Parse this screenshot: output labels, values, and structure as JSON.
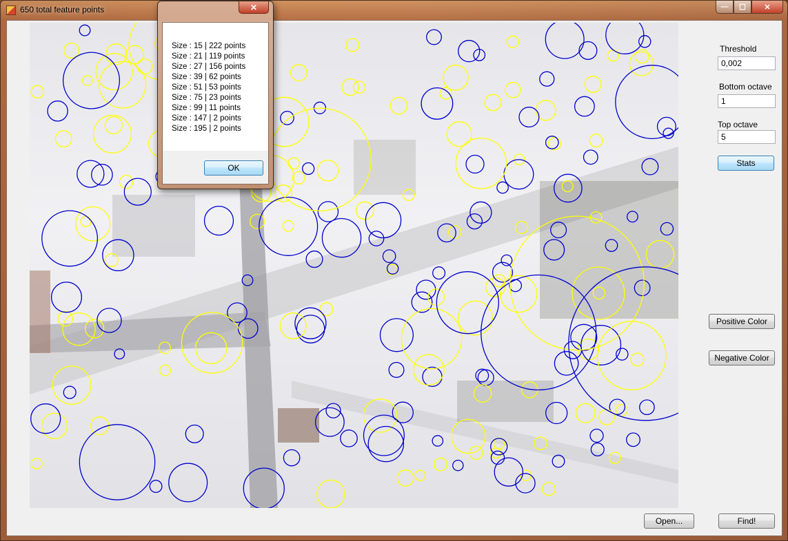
{
  "window": {
    "title": "650 total feature points",
    "caption_buttons": {
      "minimize": "—",
      "maximize": "☐",
      "close": "✕"
    }
  },
  "panel": {
    "threshold_label": "Threshold",
    "threshold_value": "0,002",
    "bottom_octave_label": "Bottom octave",
    "bottom_octave_value": "1",
    "top_octave_label": "Top octave",
    "top_octave_value": "5",
    "stats_button": "Stats",
    "positive_color_button": "Positive Color",
    "negative_color_button": "Negative Color",
    "open_button": "Open...",
    "find_button": "Find!"
  },
  "dialog": {
    "close_glyph": "✕",
    "lines": [
      "Size : 15 | 222 points",
      "Size : 21 | 119 points",
      "Size : 27 | 156 points",
      "Size : 39 | 62 points",
      "Size : 51 | 53 points",
      "Size : 75 | 23 points",
      "Size : 99 | 11 points",
      "Size : 147 | 2 points",
      "Size : 195 | 2 points"
    ],
    "ok_button": "OK"
  },
  "colors": {
    "positive": "#ffff00",
    "negative": "#0000cc"
  }
}
